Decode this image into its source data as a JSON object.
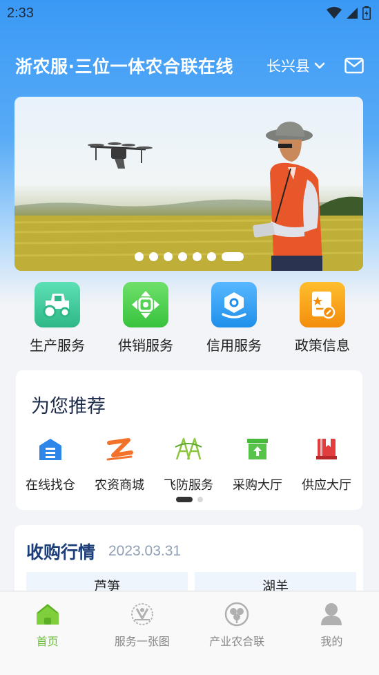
{
  "status_bar": {
    "time": "2:33"
  },
  "header": {
    "title": "浙农服·三位一体农合联在线",
    "region": "长兴县"
  },
  "banner": {
    "slide_count": 7,
    "active_index": 6
  },
  "quick_services": [
    {
      "label": "生产服务",
      "icon": "tractor-icon",
      "color": "#3fc59a"
    },
    {
      "label": "供销服务",
      "icon": "dpad-icon",
      "color": "#4fcf52"
    },
    {
      "label": "信用服务",
      "icon": "credit-icon",
      "color": "#2e9bf0"
    },
    {
      "label": "政策信息",
      "icon": "policy-icon",
      "color": "#f7a21a"
    }
  ],
  "recommend": {
    "title": "为您推荐",
    "items": [
      {
        "label": "在线找仓",
        "icon": "warehouse-icon"
      },
      {
        "label": "农资商城",
        "icon": "mall-icon"
      },
      {
        "label": "飞防服务",
        "icon": "drone-service-icon"
      },
      {
        "label": "采购大厅",
        "icon": "purchase-icon"
      },
      {
        "label": "供应大厅",
        "icon": "supply-icon"
      }
    ]
  },
  "market": {
    "title": "收购行情",
    "date": "2023.03.31",
    "columns": [
      "芦笋",
      "湖羊"
    ]
  },
  "tabs": [
    {
      "label": "首页",
      "icon": "home-icon",
      "active": true
    },
    {
      "label": "服务一张图",
      "icon": "service-map-icon",
      "active": false
    },
    {
      "label": "产业农合联",
      "icon": "cooperative-icon",
      "active": false
    },
    {
      "label": "我的",
      "icon": "profile-icon",
      "active": false
    }
  ],
  "colors": {
    "accent": "#3a99f5",
    "tab_active": "#6bbf3a",
    "title_dark": "#1b3d78"
  }
}
